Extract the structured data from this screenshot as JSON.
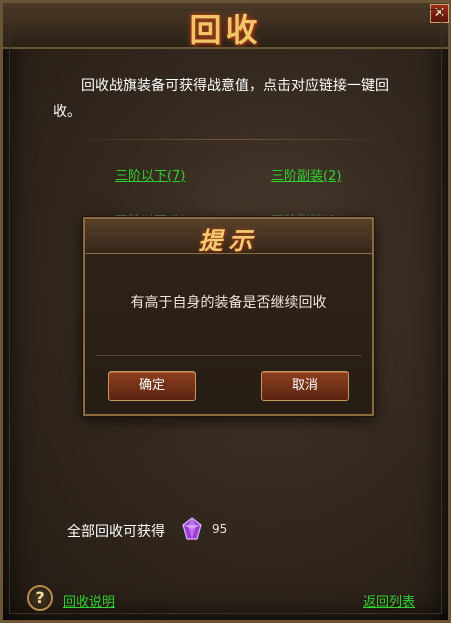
{
  "window": {
    "title": "回收",
    "close_label": "✕"
  },
  "intro_text": "回收战旗装备可获得战意值，点击对应链接一键回收。",
  "links": {
    "row1_left": "三阶以下(7)",
    "row1_right": "三阶副装(2)",
    "row2_left": "四阶以下(1)",
    "row2_right": "四阶副装(1)"
  },
  "dialog": {
    "title": "提示",
    "message": "有高于自身的装备是否继续回收",
    "ok_label": "确定",
    "cancel_label": "取消"
  },
  "footer": {
    "gain_label": "全部回收可获得",
    "gain_value": "95",
    "help_icon": "question-icon",
    "help_link": "回收说明",
    "back_link": "返回列表"
  },
  "colors": {
    "link_green": "#2fd12f",
    "title_gold": "#f1c66a",
    "button_red": "#8d3f1f",
    "gem_purple": "#b24fe0"
  }
}
